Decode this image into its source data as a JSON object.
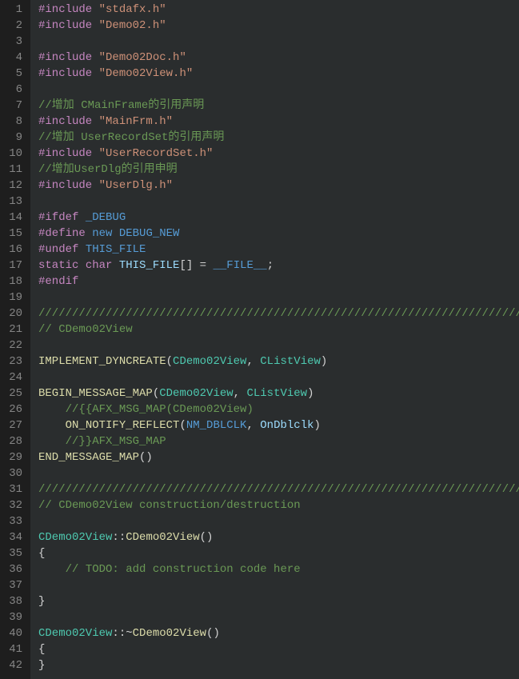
{
  "editor": {
    "language": "cpp",
    "lines": [
      {
        "num": 1,
        "tokens": [
          {
            "cls": "k",
            "t": "#include"
          },
          {
            "cls": "p",
            "t": " "
          },
          {
            "cls": "s",
            "t": "\"stdafx.h\""
          }
        ]
      },
      {
        "num": 2,
        "tokens": [
          {
            "cls": "k",
            "t": "#include"
          },
          {
            "cls": "p",
            "t": " "
          },
          {
            "cls": "s",
            "t": "\"Demo02.h\""
          }
        ]
      },
      {
        "num": 3,
        "tokens": []
      },
      {
        "num": 4,
        "tokens": [
          {
            "cls": "k",
            "t": "#include"
          },
          {
            "cls": "p",
            "t": " "
          },
          {
            "cls": "s",
            "t": "\"Demo02Doc.h\""
          }
        ]
      },
      {
        "num": 5,
        "tokens": [
          {
            "cls": "k",
            "t": "#include"
          },
          {
            "cls": "p",
            "t": " "
          },
          {
            "cls": "s",
            "t": "\"Demo02View.h\""
          }
        ]
      },
      {
        "num": 6,
        "tokens": []
      },
      {
        "num": 7,
        "tokens": [
          {
            "cls": "c",
            "t": "//增加 CMainFrame的引用声明"
          }
        ]
      },
      {
        "num": 8,
        "tokens": [
          {
            "cls": "k",
            "t": "#include"
          },
          {
            "cls": "p",
            "t": " "
          },
          {
            "cls": "s",
            "t": "\"MainFrm.h\""
          }
        ]
      },
      {
        "num": 9,
        "tokens": [
          {
            "cls": "c",
            "t": "//增加 UserRecordSet的引用声明"
          }
        ]
      },
      {
        "num": 10,
        "tokens": [
          {
            "cls": "k",
            "t": "#include"
          },
          {
            "cls": "p",
            "t": " "
          },
          {
            "cls": "s",
            "t": "\"UserRecordSet.h\""
          }
        ]
      },
      {
        "num": 11,
        "tokens": [
          {
            "cls": "c",
            "t": "//增加UserDlg的引用申明"
          }
        ]
      },
      {
        "num": 12,
        "tokens": [
          {
            "cls": "k",
            "t": "#include"
          },
          {
            "cls": "p",
            "t": " "
          },
          {
            "cls": "s",
            "t": "\"UserDlg.h\""
          }
        ]
      },
      {
        "num": 13,
        "tokens": []
      },
      {
        "num": 14,
        "tokens": [
          {
            "cls": "k",
            "t": "#ifdef"
          },
          {
            "cls": "p",
            "t": " "
          },
          {
            "cls": "d",
            "t": "_DEBUG"
          }
        ]
      },
      {
        "num": 15,
        "tokens": [
          {
            "cls": "k",
            "t": "#define"
          },
          {
            "cls": "p",
            "t": " "
          },
          {
            "cls": "d",
            "t": "new"
          },
          {
            "cls": "p",
            "t": " "
          },
          {
            "cls": "d",
            "t": "DEBUG_NEW"
          }
        ]
      },
      {
        "num": 16,
        "tokens": [
          {
            "cls": "k",
            "t": "#undef"
          },
          {
            "cls": "p",
            "t": " "
          },
          {
            "cls": "d",
            "t": "THIS_FILE"
          }
        ]
      },
      {
        "num": 17,
        "tokens": [
          {
            "cls": "k",
            "t": "static"
          },
          {
            "cls": "p",
            "t": " "
          },
          {
            "cls": "k",
            "t": "char"
          },
          {
            "cls": "p",
            "t": " "
          },
          {
            "cls": "v",
            "t": "THIS_FILE"
          },
          {
            "cls": "p",
            "t": "[] = "
          },
          {
            "cls": "d",
            "t": "__FILE__"
          },
          {
            "cls": "p",
            "t": ";"
          }
        ]
      },
      {
        "num": 18,
        "tokens": [
          {
            "cls": "k",
            "t": "#endif"
          }
        ]
      },
      {
        "num": 19,
        "tokens": []
      },
      {
        "num": 20,
        "tokens": [
          {
            "cls": "c",
            "t": "/////////////////////////////////////////////////////////////////////////////"
          }
        ]
      },
      {
        "num": 21,
        "tokens": [
          {
            "cls": "c",
            "t": "// CDemo02View"
          }
        ]
      },
      {
        "num": 22,
        "tokens": []
      },
      {
        "num": 23,
        "tokens": [
          {
            "cls": "f",
            "t": "IMPLEMENT_DYNCREATE"
          },
          {
            "cls": "p",
            "t": "("
          },
          {
            "cls": "t",
            "t": "CDemo02View"
          },
          {
            "cls": "p",
            "t": ", "
          },
          {
            "cls": "t",
            "t": "CListView"
          },
          {
            "cls": "p",
            "t": ")"
          }
        ]
      },
      {
        "num": 24,
        "tokens": []
      },
      {
        "num": 25,
        "tokens": [
          {
            "cls": "f",
            "t": "BEGIN_MESSAGE_MAP"
          },
          {
            "cls": "p",
            "t": "("
          },
          {
            "cls": "t",
            "t": "CDemo02View"
          },
          {
            "cls": "p",
            "t": ", "
          },
          {
            "cls": "t",
            "t": "CListView"
          },
          {
            "cls": "p",
            "t": ")"
          }
        ]
      },
      {
        "num": 26,
        "tokens": [
          {
            "cls": "p",
            "t": "    "
          },
          {
            "cls": "c",
            "t": "//{{AFX_MSG_MAP(CDemo02View)"
          }
        ]
      },
      {
        "num": 27,
        "tokens": [
          {
            "cls": "p",
            "t": "    "
          },
          {
            "cls": "f",
            "t": "ON_NOTIFY_REFLECT"
          },
          {
            "cls": "p",
            "t": "("
          },
          {
            "cls": "d",
            "t": "NM_DBLCLK"
          },
          {
            "cls": "p",
            "t": ", "
          },
          {
            "cls": "v",
            "t": "OnDblclk"
          },
          {
            "cls": "p",
            "t": ")"
          }
        ]
      },
      {
        "num": 28,
        "tokens": [
          {
            "cls": "p",
            "t": "    "
          },
          {
            "cls": "c",
            "t": "//}}AFX_MSG_MAP"
          }
        ]
      },
      {
        "num": 29,
        "tokens": [
          {
            "cls": "f",
            "t": "END_MESSAGE_MAP"
          },
          {
            "cls": "p",
            "t": "()"
          }
        ]
      },
      {
        "num": 30,
        "tokens": []
      },
      {
        "num": 31,
        "tokens": [
          {
            "cls": "c",
            "t": "/////////////////////////////////////////////////////////////////////////////"
          }
        ]
      },
      {
        "num": 32,
        "tokens": [
          {
            "cls": "c",
            "t": "// CDemo02View construction/destruction"
          }
        ]
      },
      {
        "num": 33,
        "tokens": []
      },
      {
        "num": 34,
        "tokens": [
          {
            "cls": "t",
            "t": "CDemo02View"
          },
          {
            "cls": "p",
            "t": "::"
          },
          {
            "cls": "f",
            "t": "CDemo02View"
          },
          {
            "cls": "p",
            "t": "()"
          }
        ]
      },
      {
        "num": 35,
        "tokens": [
          {
            "cls": "p",
            "t": "{"
          }
        ]
      },
      {
        "num": 36,
        "tokens": [
          {
            "cls": "p",
            "t": "    "
          },
          {
            "cls": "c",
            "t": "// TODO: add construction code here"
          }
        ]
      },
      {
        "num": 37,
        "tokens": []
      },
      {
        "num": 38,
        "tokens": [
          {
            "cls": "p",
            "t": "}"
          }
        ]
      },
      {
        "num": 39,
        "tokens": []
      },
      {
        "num": 40,
        "tokens": [
          {
            "cls": "t",
            "t": "CDemo02View"
          },
          {
            "cls": "p",
            "t": "::~"
          },
          {
            "cls": "f",
            "t": "CDemo02View"
          },
          {
            "cls": "p",
            "t": "()"
          }
        ]
      },
      {
        "num": 41,
        "tokens": [
          {
            "cls": "p",
            "t": "{"
          }
        ]
      },
      {
        "num": 42,
        "tokens": [
          {
            "cls": "p",
            "t": "}"
          }
        ]
      }
    ]
  }
}
